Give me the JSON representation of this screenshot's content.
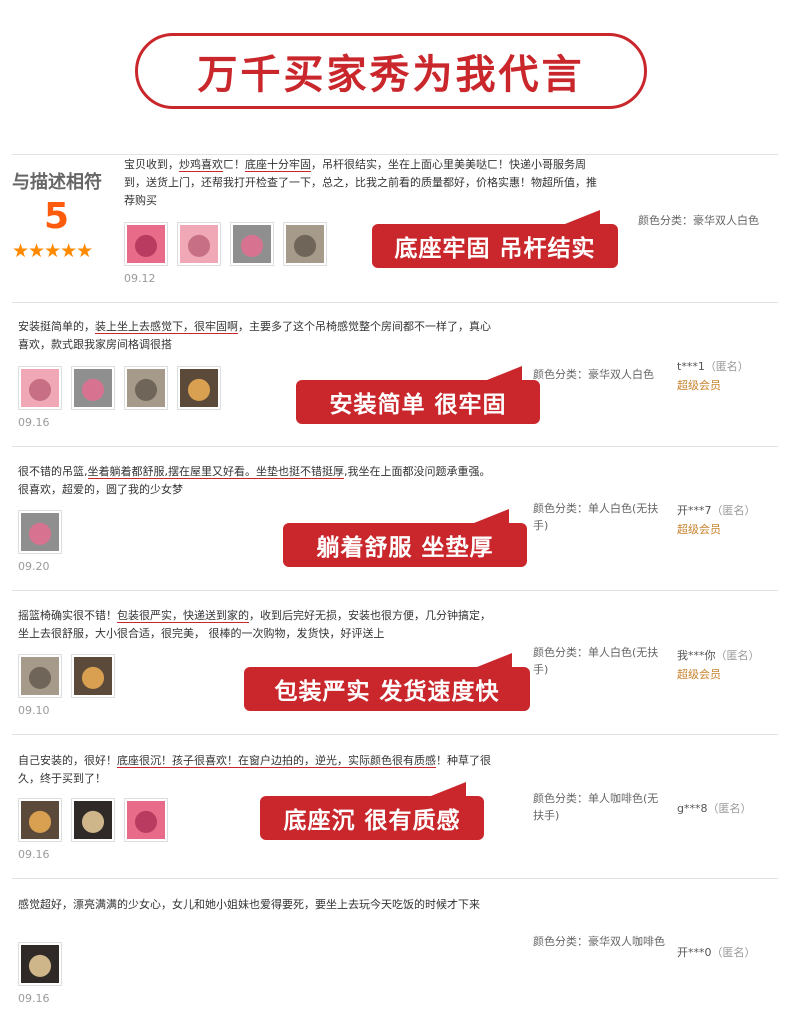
{
  "banner": {
    "title": "万千买家秀为我代言"
  },
  "score": {
    "label": "与描述相符",
    "value": "5",
    "stars": "★★★★★"
  },
  "reviews": [
    {
      "text_parts": [
        {
          "t": "宝贝收到，"
        },
        {
          "t": "炒鸡喜欢",
          "u": true
        },
        {
          "t": "ㄈ！"
        },
        {
          "t": "底座十分牢固",
          "u": true
        },
        {
          "t": "，吊杆很结实，坐在上面心里美美哒ㄈ！快递小哥服务周到，送货上门，还帮我打开检查了一下，总之，比我之前看的质量都好，价格实惠！物超所值，推荐购买"
        }
      ],
      "date": "09.12",
      "spec": "颜色分类：豪华双人白色",
      "user": "",
      "vip": "",
      "tag": "底座牢固 吊杆结实",
      "thumbs": 4
    },
    {
      "text_parts": [
        {
          "t": "安装挺简单的，"
        },
        {
          "t": "装上坐上去感觉下，很牢固啊",
          "u": true
        },
        {
          "t": "，主要多了这个吊椅感觉整个房间都不一样了，真心喜欢，款式跟我家房间格调很搭"
        }
      ],
      "date": "09.16",
      "spec": "颜色分类：豪华双人白色",
      "user": "t***1",
      "anon": "（匿名）",
      "vip": "超级会员",
      "tag": "安装简单 很牢固",
      "thumbs": 4
    },
    {
      "text_parts": [
        {
          "t": "很不错的吊篮,"
        },
        {
          "t": "坐着躺着都舒服,摆在屋里又好看。坐垫也挺不错挺厚",
          "u": true
        },
        {
          "t": ",我坐在上面都没问题承重强。很喜欢，超爱的，圆了我的少女梦"
        }
      ],
      "date": "09.20",
      "spec": "颜色分类：单人白色(无扶手)",
      "user": "开***7",
      "anon": "（匿名）",
      "vip": "超级会员",
      "tag": "躺着舒服 坐垫厚",
      "thumbs": 1
    },
    {
      "text_parts": [
        {
          "t": "摇篮椅确实很不错！"
        },
        {
          "t": "包装很严实，快递送到家的",
          "u": true
        },
        {
          "t": "，收到后完好无损，安装也很方便，几分钟搞定，坐上去很舒服，大小很合适，很完美， 很棒的一次购物，发货快，好评送上"
        }
      ],
      "date": "09.10",
      "spec": "颜色分类：单人白色(无扶手)",
      "user": "我***你",
      "anon": "（匿名）",
      "vip": "超级会员",
      "tag": "包装严实 发货速度快",
      "thumbs": 2
    },
    {
      "text_parts": [
        {
          "t": "自己安装的，很好！"
        },
        {
          "t": "底座很沉！孩子很喜欢！在窗户边拍的，逆光，实际颜色很有质感",
          "u": true
        },
        {
          "t": "！种草了很久，终于买到了！"
        }
      ],
      "date": "09.16",
      "spec": "颜色分类：单人咖啡色(无扶手)",
      "user": "g***8",
      "anon": "（匿名）",
      "vip": "",
      "tag": "底座沉 很有质感",
      "thumbs": 3
    },
    {
      "text_parts": [
        {
          "t": "感觉超好，漂亮满满的少女心，女儿和她小姐妹也爱得要死，要坐上去玩今天吃饭的时候才下来"
        }
      ],
      "date": "09.16",
      "spec": "颜色分类：豪华双人咖啡色",
      "user": "开***0",
      "anon": "（匿名）",
      "vip": "",
      "tag": "",
      "thumbs": 1
    }
  ],
  "colors": {
    "accent": "#c9272c",
    "vip": "#c9822c",
    "score": "#ff5b0c",
    "stars": "#ff8a00"
  }
}
